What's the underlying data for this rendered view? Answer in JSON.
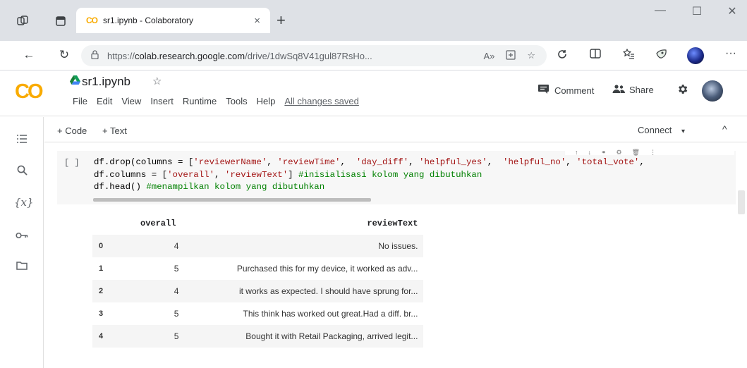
{
  "browser": {
    "tab": {
      "favicon": "CO",
      "title": "sr1.ipynb - Colaboratory",
      "close": "×"
    },
    "new_tab": "+",
    "window": {
      "minimize": "—",
      "maximize": "☐",
      "close": "✕"
    },
    "nav": {
      "back": "←",
      "reload": "↻"
    },
    "url": {
      "prefix": "https://",
      "host": "colab.research.google.com",
      "path": "/drive/1dwSq8V41gul87RsHo...",
      "read_aloud": "A»"
    },
    "menu_dots": "···"
  },
  "colab": {
    "logo": "CO",
    "notebook_title": "sr1.ipynb",
    "menu": [
      "File",
      "Edit",
      "View",
      "Insert",
      "Runtime",
      "Tools",
      "Help"
    ],
    "save_status": "All changes saved",
    "comment_label": "Comment",
    "share_label": "Share"
  },
  "toolbar": {
    "add_code": "+ Code",
    "add_text": "+ Text",
    "connect": "Connect",
    "connect_caret": "▾",
    "collapse": "^"
  },
  "cell": {
    "run_indicator": "[ ]",
    "code_lines": [
      {
        "parts": [
          {
            "t": "df.drop(columns = [",
            "k": "f"
          },
          {
            "t": "'reviewerName'",
            "k": "s"
          },
          {
            "t": ", ",
            "k": "f"
          },
          {
            "t": "'reviewTime'",
            "k": "s"
          },
          {
            "t": ",  ",
            "k": "f"
          },
          {
            "t": "'day_diff'",
            "k": "s"
          },
          {
            "t": ", ",
            "k": "f"
          },
          {
            "t": "'helpful_yes'",
            "k": "s"
          },
          {
            "t": ",  ",
            "k": "f"
          },
          {
            "t": "'helpful_no'",
            "k": "s"
          },
          {
            "t": ", ",
            "k": "f"
          },
          {
            "t": "'total_vote'",
            "k": "s"
          },
          {
            "t": ",",
            "k": "f"
          }
        ]
      },
      {
        "parts": [
          {
            "t": "df.columns = [",
            "k": "f"
          },
          {
            "t": "'overall'",
            "k": "s"
          },
          {
            "t": ", ",
            "k": "f"
          },
          {
            "t": "'reviewText'",
            "k": "s"
          },
          {
            "t": "] ",
            "k": "f"
          },
          {
            "t": "#inisialisasi kolom yang dibutuhkan",
            "k": "c"
          }
        ]
      },
      {
        "parts": [
          {
            "t": "df.head() ",
            "k": "f"
          },
          {
            "t": "#menampilkan kolom yang dibutuhkan",
            "k": "c"
          }
        ]
      }
    ]
  },
  "output_table": {
    "columns": [
      "",
      "overall",
      "reviewText"
    ],
    "rows": [
      {
        "index": "0",
        "overall": "4",
        "reviewText": "No issues."
      },
      {
        "index": "1",
        "overall": "5",
        "reviewText": "Purchased this for my device, it worked as adv..."
      },
      {
        "index": "2",
        "overall": "4",
        "reviewText": "it works as expected. I should have sprung for..."
      },
      {
        "index": "3",
        "overall": "5",
        "reviewText": "This think has worked out great.Had a diff. br..."
      },
      {
        "index": "4",
        "overall": "5",
        "reviewText": "Bought it with Retail Packaging, arrived legit..."
      }
    ]
  }
}
